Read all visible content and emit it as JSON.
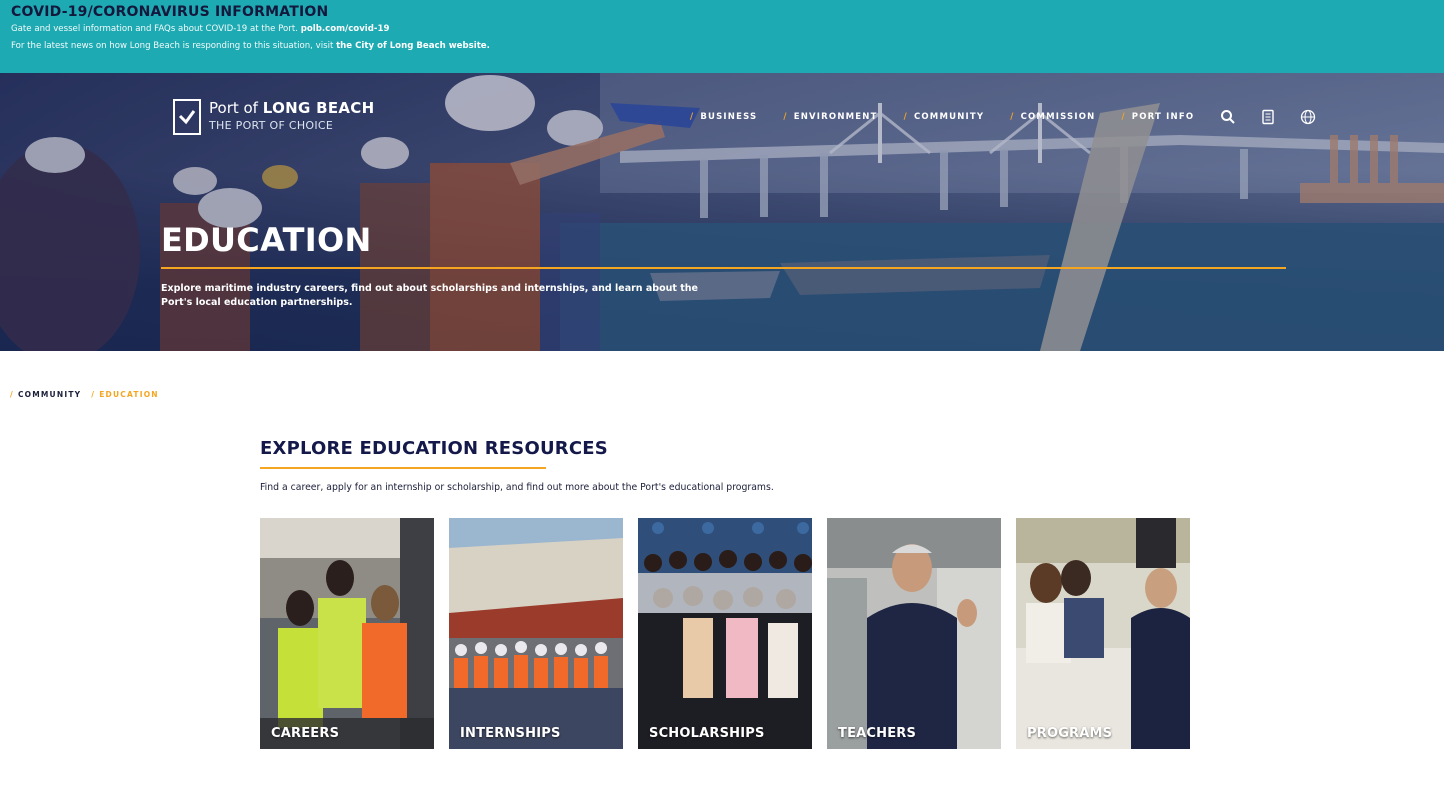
{
  "covid_banner": {
    "title": "COVID-19/CORONAVIRUS INFORMATION",
    "line1_text": "Gate and vessel information and FAQs about COVID-19 at the Port.",
    "line1_link": "polb.com/covid-19",
    "line2_text": "For the latest news on how Long Beach is responding to this situation, visit",
    "line2_link": "the City of Long Beach website."
  },
  "header": {
    "logo_prefix": "Port of",
    "logo_name": "LONG BEACH",
    "logo_tagline": "THE PORT OF CHOICE",
    "nav": [
      {
        "label": "BUSINESS"
      },
      {
        "label": "ENVIRONMENT"
      },
      {
        "label": "COMMUNITY"
      },
      {
        "label": "COMMISSION"
      },
      {
        "label": "PORT INFO"
      }
    ],
    "icons": [
      "search-icon",
      "document-icon",
      "globe-icon"
    ]
  },
  "hero": {
    "title": "EDUCATION",
    "description": "Explore maritime industry careers, find out about scholarships and internships, and learn about the Port's local education partnerships."
  },
  "breadcrumb": {
    "items": [
      {
        "label": "COMMUNITY"
      },
      {
        "label": "EDUCATION"
      }
    ]
  },
  "section": {
    "title": "EXPLORE EDUCATION RESOURCES",
    "description": "Find a career, apply for an internship or scholarship, and find out more about the Port's educational programs."
  },
  "cards": [
    {
      "label": "CAREERS"
    },
    {
      "label": "INTERNSHIPS"
    },
    {
      "label": "SCHOLARSHIPS"
    },
    {
      "label": "TEACHERS"
    },
    {
      "label": "PROGRAMS"
    }
  ],
  "colors": {
    "banner_bg": "#1eaab2",
    "navy": "#14194a",
    "accent_gold": "#f4a621"
  }
}
